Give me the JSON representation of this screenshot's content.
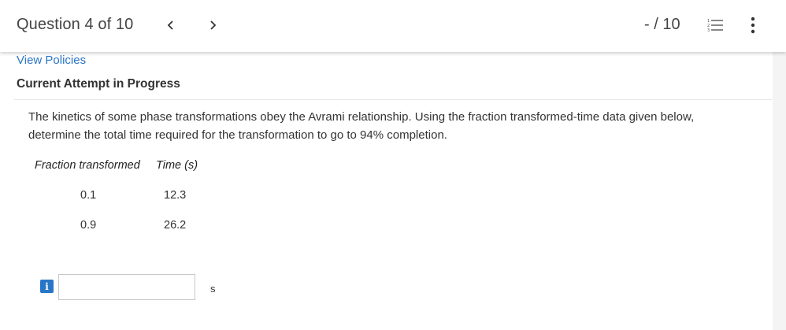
{
  "header": {
    "question_label": "Question 4 of 10",
    "prev_glyph": "<",
    "next_glyph": ">",
    "score": "- / 10"
  },
  "links": {
    "view_policies": "View Policies"
  },
  "attempt_status": "Current Attempt in Progress",
  "question": {
    "text": "The kinetics of some phase transformations obey the Avrami relationship. Using the fraction transformed-time data given below, determine the total time required for the transformation to go to 94% completion."
  },
  "data_table": {
    "headers": [
      "Fraction transformed",
      "Time (s)"
    ],
    "rows": [
      [
        "0.1",
        "12.3"
      ],
      [
        "0.9",
        "26.2"
      ]
    ]
  },
  "answer": {
    "info_glyph": "i",
    "value": "",
    "unit": "s"
  },
  "colors": {
    "link": "#2a76c6",
    "info_button": "#2a76c6"
  },
  "icons": {
    "prev": "chevron-left-icon",
    "next": "chevron-right-icon",
    "question_list": "numbered-list-icon",
    "more": "vertical-ellipsis-icon",
    "info": "info-icon"
  }
}
